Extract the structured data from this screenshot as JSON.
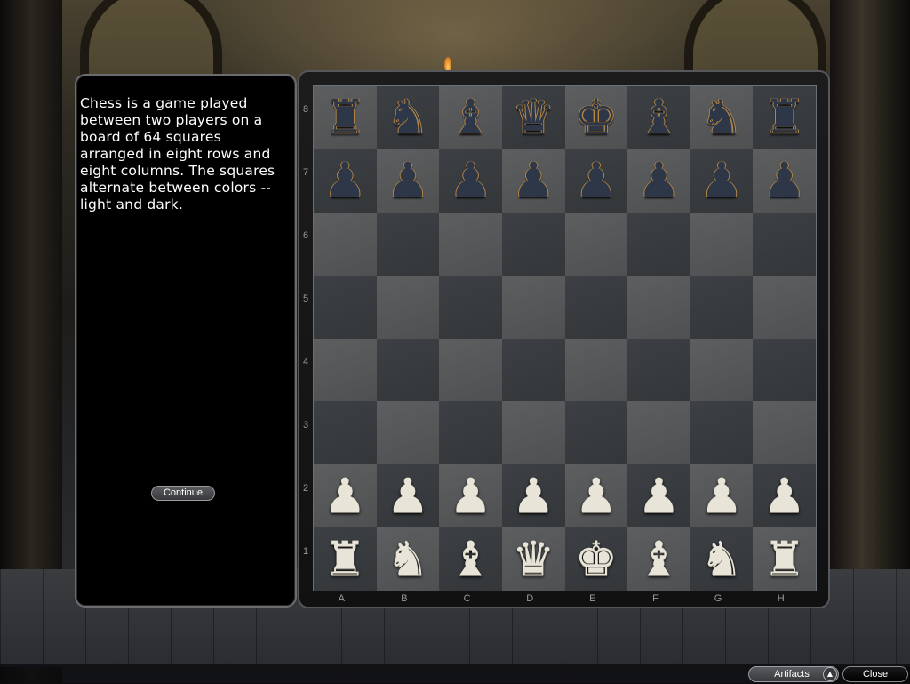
{
  "info_panel": {
    "text": "Chess is a game played between two players on a board of 64 squares arranged in eight rows and eight columns. The squares alternate between colors -- light and dark.",
    "continue_label": "Continue"
  },
  "board": {
    "files": [
      "A",
      "B",
      "C",
      "D",
      "E",
      "F",
      "G",
      "H"
    ],
    "ranks": [
      "8",
      "7",
      "6",
      "5",
      "4",
      "3",
      "2",
      "1"
    ],
    "rows": [
      [
        {
          "p": "♜",
          "c": "black",
          "n": "black-rook"
        },
        {
          "p": "♞",
          "c": "black",
          "n": "black-knight"
        },
        {
          "p": "♝",
          "c": "black",
          "n": "black-bishop"
        },
        {
          "p": "♛",
          "c": "black",
          "n": "black-queen"
        },
        {
          "p": "♚",
          "c": "black",
          "n": "black-king"
        },
        {
          "p": "♝",
          "c": "black",
          "n": "black-bishop"
        },
        {
          "p": "♞",
          "c": "black",
          "n": "black-knight"
        },
        {
          "p": "♜",
          "c": "black",
          "n": "black-rook"
        }
      ],
      [
        {
          "p": "♟",
          "c": "black",
          "n": "black-pawn"
        },
        {
          "p": "♟",
          "c": "black",
          "n": "black-pawn"
        },
        {
          "p": "♟",
          "c": "black",
          "n": "black-pawn"
        },
        {
          "p": "♟",
          "c": "black",
          "n": "black-pawn"
        },
        {
          "p": "♟",
          "c": "black",
          "n": "black-pawn"
        },
        {
          "p": "♟",
          "c": "black",
          "n": "black-pawn"
        },
        {
          "p": "♟",
          "c": "black",
          "n": "black-pawn"
        },
        {
          "p": "♟",
          "c": "black",
          "n": "black-pawn"
        }
      ],
      [
        null,
        null,
        null,
        null,
        null,
        null,
        null,
        null
      ],
      [
        null,
        null,
        null,
        null,
        null,
        null,
        null,
        null
      ],
      [
        null,
        null,
        null,
        null,
        null,
        null,
        null,
        null
      ],
      [
        null,
        null,
        null,
        null,
        null,
        null,
        null,
        null
      ],
      [
        {
          "p": "♟",
          "c": "white",
          "n": "white-pawn"
        },
        {
          "p": "♟",
          "c": "white",
          "n": "white-pawn"
        },
        {
          "p": "♟",
          "c": "white",
          "n": "white-pawn"
        },
        {
          "p": "♟",
          "c": "white",
          "n": "white-pawn"
        },
        {
          "p": "♟",
          "c": "white",
          "n": "white-pawn"
        },
        {
          "p": "♟",
          "c": "white",
          "n": "white-pawn"
        },
        {
          "p": "♟",
          "c": "white",
          "n": "white-pawn"
        },
        {
          "p": "♟",
          "c": "white",
          "n": "white-pawn"
        }
      ],
      [
        {
          "p": "♜",
          "c": "white",
          "n": "white-rook"
        },
        {
          "p": "♞",
          "c": "white",
          "n": "white-knight"
        },
        {
          "p": "♝",
          "c": "white",
          "n": "white-bishop"
        },
        {
          "p": "♛",
          "c": "white",
          "n": "white-queen"
        },
        {
          "p": "♚",
          "c": "white",
          "n": "white-king"
        },
        {
          "p": "♝",
          "c": "white",
          "n": "white-bishop"
        },
        {
          "p": "♞",
          "c": "white",
          "n": "white-knight"
        },
        {
          "p": "♜",
          "c": "white",
          "n": "white-rook"
        }
      ]
    ]
  },
  "bottom_bar": {
    "artifacts_label": "Artifacts",
    "artifacts_toggle_icon": "▲",
    "close_label": "Close"
  }
}
